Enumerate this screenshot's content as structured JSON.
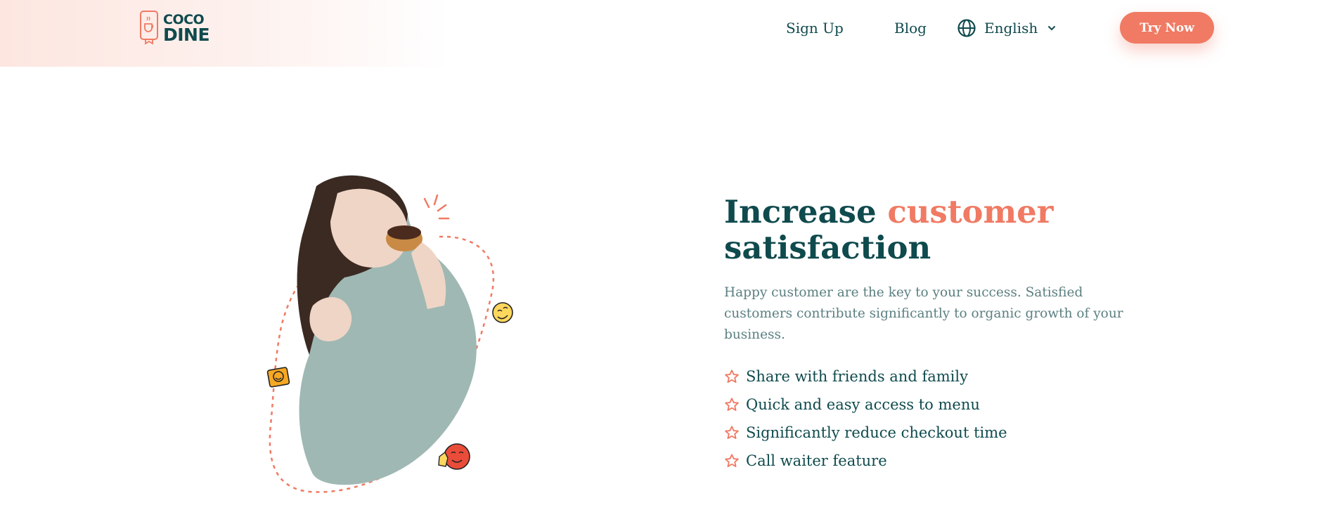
{
  "brand": {
    "line1": "COCO",
    "line2": "DINE"
  },
  "nav": {
    "signup_label": "Sign Up",
    "blog_label": "Blog",
    "language_label": "English",
    "try_now_label": "Try Now"
  },
  "section": {
    "headline_part1": "Increase",
    "headline_accent": "customer",
    "headline_part2": "satisfaction",
    "description": "Happy customer are the key to your success. Satisfied customers contribute significantly to organic growth of your business.",
    "features": [
      "Share with friends and family",
      "Quick and easy access to menu",
      "Significantly reduce checkout time",
      "Call waiter feature"
    ]
  },
  "icons": {
    "language": "globe-icon",
    "dropdown": "chevron-down-icon",
    "feature_bullet": "star-outline-icon"
  },
  "colors": {
    "primary": "#0f4a4d",
    "accent": "#f07a63",
    "muted_text": "#5b7f80",
    "header_tint": "#fde6e0"
  }
}
